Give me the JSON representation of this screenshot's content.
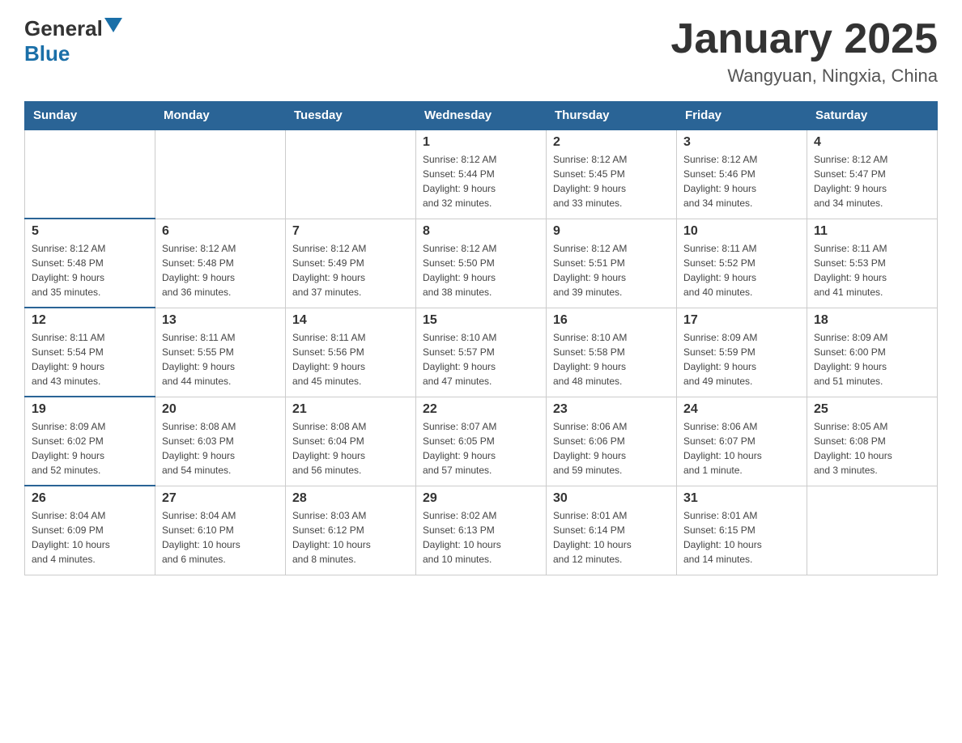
{
  "header": {
    "logo": {
      "general": "General",
      "blue": "Blue"
    },
    "title": "January 2025",
    "subtitle": "Wangyuan, Ningxia, China"
  },
  "days_of_week": [
    "Sunday",
    "Monday",
    "Tuesday",
    "Wednesday",
    "Thursday",
    "Friday",
    "Saturday"
  ],
  "weeks": [
    [
      {
        "day": "",
        "info": ""
      },
      {
        "day": "",
        "info": ""
      },
      {
        "day": "",
        "info": ""
      },
      {
        "day": "1",
        "info": "Sunrise: 8:12 AM\nSunset: 5:44 PM\nDaylight: 9 hours\nand 32 minutes."
      },
      {
        "day": "2",
        "info": "Sunrise: 8:12 AM\nSunset: 5:45 PM\nDaylight: 9 hours\nand 33 minutes."
      },
      {
        "day": "3",
        "info": "Sunrise: 8:12 AM\nSunset: 5:46 PM\nDaylight: 9 hours\nand 34 minutes."
      },
      {
        "day": "4",
        "info": "Sunrise: 8:12 AM\nSunset: 5:47 PM\nDaylight: 9 hours\nand 34 minutes."
      }
    ],
    [
      {
        "day": "5",
        "info": "Sunrise: 8:12 AM\nSunset: 5:48 PM\nDaylight: 9 hours\nand 35 minutes."
      },
      {
        "day": "6",
        "info": "Sunrise: 8:12 AM\nSunset: 5:48 PM\nDaylight: 9 hours\nand 36 minutes."
      },
      {
        "day": "7",
        "info": "Sunrise: 8:12 AM\nSunset: 5:49 PM\nDaylight: 9 hours\nand 37 minutes."
      },
      {
        "day": "8",
        "info": "Sunrise: 8:12 AM\nSunset: 5:50 PM\nDaylight: 9 hours\nand 38 minutes."
      },
      {
        "day": "9",
        "info": "Sunrise: 8:12 AM\nSunset: 5:51 PM\nDaylight: 9 hours\nand 39 minutes."
      },
      {
        "day": "10",
        "info": "Sunrise: 8:11 AM\nSunset: 5:52 PM\nDaylight: 9 hours\nand 40 minutes."
      },
      {
        "day": "11",
        "info": "Sunrise: 8:11 AM\nSunset: 5:53 PM\nDaylight: 9 hours\nand 41 minutes."
      }
    ],
    [
      {
        "day": "12",
        "info": "Sunrise: 8:11 AM\nSunset: 5:54 PM\nDaylight: 9 hours\nand 43 minutes."
      },
      {
        "day": "13",
        "info": "Sunrise: 8:11 AM\nSunset: 5:55 PM\nDaylight: 9 hours\nand 44 minutes."
      },
      {
        "day": "14",
        "info": "Sunrise: 8:11 AM\nSunset: 5:56 PM\nDaylight: 9 hours\nand 45 minutes."
      },
      {
        "day": "15",
        "info": "Sunrise: 8:10 AM\nSunset: 5:57 PM\nDaylight: 9 hours\nand 47 minutes."
      },
      {
        "day": "16",
        "info": "Sunrise: 8:10 AM\nSunset: 5:58 PM\nDaylight: 9 hours\nand 48 minutes."
      },
      {
        "day": "17",
        "info": "Sunrise: 8:09 AM\nSunset: 5:59 PM\nDaylight: 9 hours\nand 49 minutes."
      },
      {
        "day": "18",
        "info": "Sunrise: 8:09 AM\nSunset: 6:00 PM\nDaylight: 9 hours\nand 51 minutes."
      }
    ],
    [
      {
        "day": "19",
        "info": "Sunrise: 8:09 AM\nSunset: 6:02 PM\nDaylight: 9 hours\nand 52 minutes."
      },
      {
        "day": "20",
        "info": "Sunrise: 8:08 AM\nSunset: 6:03 PM\nDaylight: 9 hours\nand 54 minutes."
      },
      {
        "day": "21",
        "info": "Sunrise: 8:08 AM\nSunset: 6:04 PM\nDaylight: 9 hours\nand 56 minutes."
      },
      {
        "day": "22",
        "info": "Sunrise: 8:07 AM\nSunset: 6:05 PM\nDaylight: 9 hours\nand 57 minutes."
      },
      {
        "day": "23",
        "info": "Sunrise: 8:06 AM\nSunset: 6:06 PM\nDaylight: 9 hours\nand 59 minutes."
      },
      {
        "day": "24",
        "info": "Sunrise: 8:06 AM\nSunset: 6:07 PM\nDaylight: 10 hours\nand 1 minute."
      },
      {
        "day": "25",
        "info": "Sunrise: 8:05 AM\nSunset: 6:08 PM\nDaylight: 10 hours\nand 3 minutes."
      }
    ],
    [
      {
        "day": "26",
        "info": "Sunrise: 8:04 AM\nSunset: 6:09 PM\nDaylight: 10 hours\nand 4 minutes."
      },
      {
        "day": "27",
        "info": "Sunrise: 8:04 AM\nSunset: 6:10 PM\nDaylight: 10 hours\nand 6 minutes."
      },
      {
        "day": "28",
        "info": "Sunrise: 8:03 AM\nSunset: 6:12 PM\nDaylight: 10 hours\nand 8 minutes."
      },
      {
        "day": "29",
        "info": "Sunrise: 8:02 AM\nSunset: 6:13 PM\nDaylight: 10 hours\nand 10 minutes."
      },
      {
        "day": "30",
        "info": "Sunrise: 8:01 AM\nSunset: 6:14 PM\nDaylight: 10 hours\nand 12 minutes."
      },
      {
        "day": "31",
        "info": "Sunrise: 8:01 AM\nSunset: 6:15 PM\nDaylight: 10 hours\nand 14 minutes."
      },
      {
        "day": "",
        "info": ""
      }
    ]
  ]
}
